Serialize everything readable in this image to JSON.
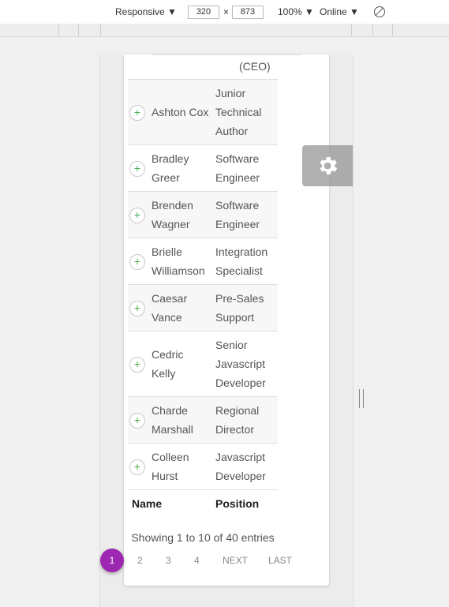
{
  "devtools": {
    "device_mode": "Responsive ▼",
    "width": "320",
    "times": "×",
    "height": "873",
    "zoom": "100% ▼",
    "network": "Online ▼",
    "rotate_icon": "rotate-icon"
  },
  "table": {
    "top_fragment": "(CEO)",
    "rows": [
      {
        "name": "Ashton Cox",
        "position": "Junior Technical Author"
      },
      {
        "name": "Bradley Greer",
        "position": "Software Engineer"
      },
      {
        "name": "Brenden Wagner",
        "position": "Software Engineer"
      },
      {
        "name": "Brielle Williamson",
        "position": "Integration Specialist"
      },
      {
        "name": "Caesar Vance",
        "position": "Pre-Sales Support"
      },
      {
        "name": "Cedric Kelly",
        "position": "Senior Javascript Developer"
      },
      {
        "name": "Charde Marshall",
        "position": "Regional Director"
      },
      {
        "name": "Colleen Hurst",
        "position": "Javascript Developer"
      }
    ],
    "expand_symbol": "+",
    "footer": {
      "name": "Name",
      "position": "Position"
    }
  },
  "info_text": "Showing 1 to 10 of 40 entries",
  "pagination": {
    "current": "1",
    "pages": [
      "2",
      "3",
      "4"
    ],
    "next": "NEXT",
    "last": "LAST"
  },
  "colors": {
    "accent": "#9c27b0",
    "expand": "#4caf50"
  }
}
